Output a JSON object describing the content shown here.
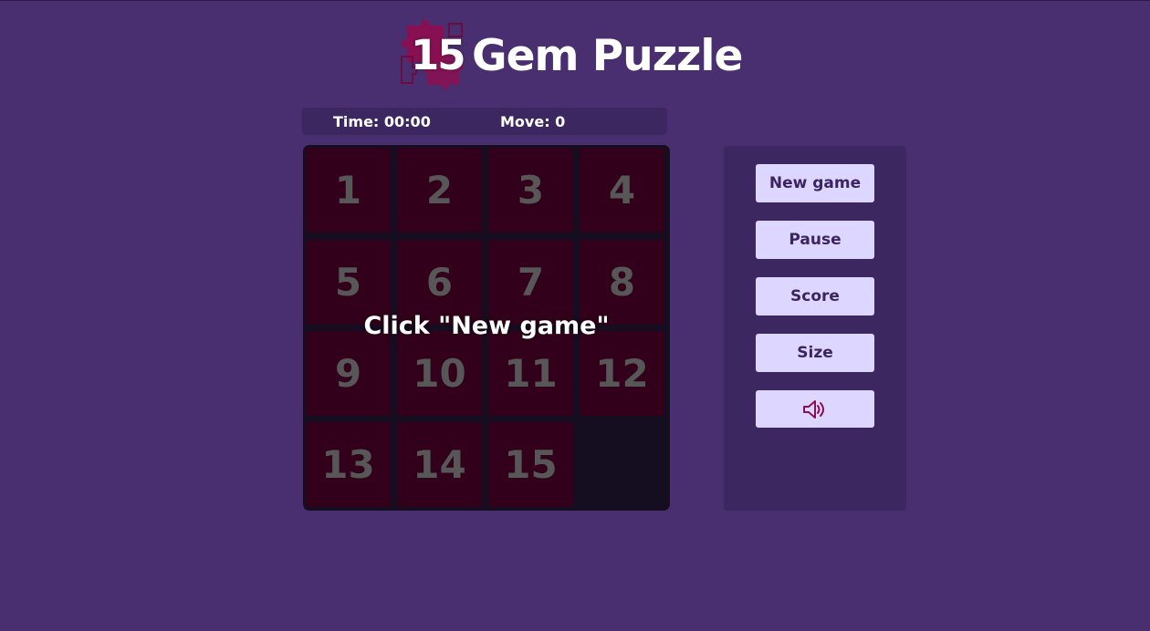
{
  "header": {
    "logo_number": "15",
    "title": "Gem Puzzle"
  },
  "stats": {
    "time": "Time: 00:00",
    "moves": "Move: 0"
  },
  "board": {
    "tiles": [
      "1",
      "2",
      "3",
      "4",
      "5",
      "6",
      "7",
      "8",
      "9",
      "10",
      "11",
      "12",
      "13",
      "14",
      "15"
    ],
    "overlay": "Click \"New game\""
  },
  "controls": {
    "new_game": "New game",
    "pause": "Pause",
    "score": "Score",
    "size": "Size",
    "sound_icon": "speaker-volume-icon"
  },
  "colors": {
    "background": "#492e70",
    "panel": "#3d2761",
    "board": "#150d20",
    "tile": "#32001a",
    "tile_text": "#575757",
    "button": "#ddd6ff",
    "button_text": "#3b2461",
    "accent": "#8a0f4f"
  }
}
